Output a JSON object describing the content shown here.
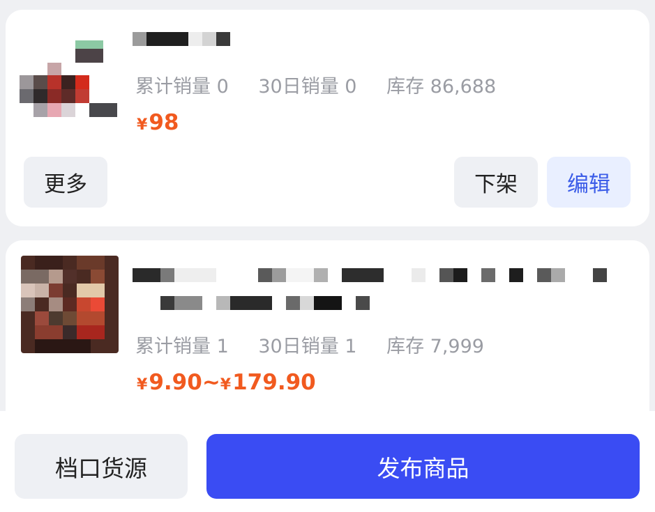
{
  "products": [
    {
      "stats": {
        "total_sales": "累计销量 0",
        "sales_30d": "30日销量 0",
        "stock": "库存 86,688"
      },
      "price_currency": "¥",
      "price": "98",
      "actions": {
        "more": "更多",
        "delist": "下架",
        "edit": "编辑"
      }
    },
    {
      "stats": {
        "total_sales": "累计销量 1",
        "sales_30d": "30日销量 1",
        "stock": "库存 7,999"
      },
      "price_currency": "¥",
      "price_low": "9.90",
      "price_sep": "~",
      "price_currency_2": "¥",
      "price_high": "179.90"
    }
  ],
  "bottom_bar": {
    "stall_source": "档口货源",
    "publish": "发布商品"
  },
  "colors": {
    "accent": "#3a4cf3",
    "price": "#f15a1f",
    "edit": "#3b5ce8"
  }
}
